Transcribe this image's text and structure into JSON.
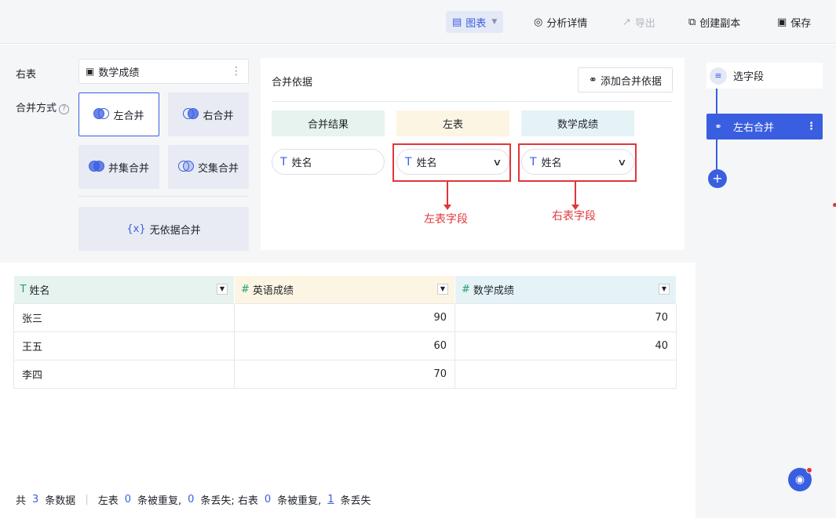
{
  "toolbar": {
    "chart": "图表",
    "analysis_detail": "分析详情",
    "export": "导出",
    "create_copy": "创建副本",
    "save": "保存"
  },
  "config": {
    "right_table_label": "右表",
    "right_table_value": "数学成绩",
    "merge_mode_label": "合并方式",
    "merge_modes": {
      "left": "左合并",
      "right": "右合并",
      "union": "并集合并",
      "intersection": "交集合并",
      "no_basis": "无依据合并"
    },
    "selected_mode": "left"
  },
  "basis": {
    "title": "合并依据",
    "add_button": "添加合并依据",
    "columns": [
      "合并结果",
      "左表",
      "数学成绩"
    ],
    "column_colors": [
      "#e7f3ee",
      "#fdf5e3",
      "#e5f3f7"
    ],
    "result_field": "姓名",
    "left_field": "姓名",
    "right_field": "姓名",
    "annotations": [
      "左表字段",
      "右表字段"
    ]
  },
  "flow": {
    "steps": [
      "选字段",
      "左右合并"
    ]
  },
  "table": {
    "headers": [
      {
        "type": "T",
        "name": "姓名",
        "bg": "#e7f3ee"
      },
      {
        "type": "#",
        "name": "英语成绩",
        "bg": "#fdf5e3"
      },
      {
        "type": "#",
        "name": "数学成绩",
        "bg": "#e5f3f7"
      }
    ],
    "rows": [
      [
        "张三",
        "90",
        "70"
      ],
      [
        "王五",
        "60",
        "40"
      ],
      [
        "李四",
        "70",
        ""
      ]
    ]
  },
  "footer": {
    "prefix": "共",
    "total": "3",
    "total_unit": "条数据",
    "left_label": "左表",
    "left_dup": "0",
    "dup_unit": "条被重复,",
    "left_lost": "0",
    "lost_unit_semi": "条丢失;",
    "right_label": "右表",
    "right_dup": "0",
    "right_lost": "1",
    "lost_unit": "条丢失"
  }
}
